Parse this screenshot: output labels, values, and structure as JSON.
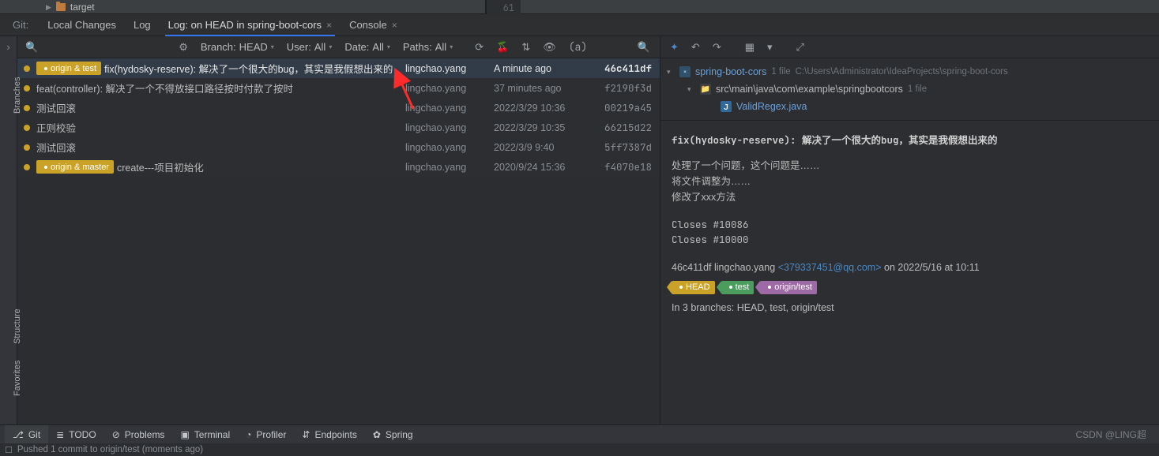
{
  "project": {
    "top_node": "target"
  },
  "editor_gutter": {
    "line": "61"
  },
  "tabs": {
    "label": "Git:",
    "items": [
      {
        "label": "Local Changes",
        "active": false,
        "closable": false
      },
      {
        "label": "Log",
        "active": false,
        "closable": false
      },
      {
        "label": "Log: on HEAD in spring-boot-cors",
        "active": true,
        "closable": true
      },
      {
        "label": "Console",
        "active": false,
        "closable": true
      }
    ]
  },
  "left_vertical": {
    "tabs": [
      "Branches"
    ],
    "lower": [
      "Structure",
      "Favorites"
    ]
  },
  "filters": {
    "branch_label": "Branch:",
    "branch_value": "HEAD",
    "user_label": "User:",
    "user_value": "All",
    "date_label": "Date:",
    "date_value": "All",
    "paths_label": "Paths:",
    "paths_value": "All"
  },
  "commits": [
    {
      "tags": [
        {
          "text": "origin & test",
          "style": "yellow",
          "icon": "purple"
        }
      ],
      "message": "fix(hydosky-reserve): 解决了一个很大的bug，其实是我假想出来的",
      "author": "lingchao.yang",
      "date": "A minute ago",
      "hash": "46c411df",
      "selected": true
    },
    {
      "tags": [],
      "message": "feat(controller): 解决了一个不得放接口路径按时付款了按时",
      "author": "lingchao.yang",
      "date": "37 minutes ago",
      "hash": "f2190f3d"
    },
    {
      "tags": [],
      "message": "测试回滚",
      "author": "lingchao.yang",
      "date": "2022/3/29 10:36",
      "hash": "00219a45"
    },
    {
      "tags": [],
      "message": "正则校验",
      "author": "lingchao.yang",
      "date": "2022/3/29 10:35",
      "hash": "66215d22"
    },
    {
      "tags": [],
      "message": "测试回滚",
      "author": "lingchao.yang",
      "date": "2022/3/9 9:40",
      "hash": "5ff7387d"
    },
    {
      "tags": [
        {
          "text": "origin & master",
          "style": "yellow",
          "icon": "purple"
        }
      ],
      "message": "create---项目初始化",
      "author": "lingchao.yang",
      "date": "2020/9/24 15:36",
      "hash": "f4070e18"
    }
  ],
  "files": {
    "root_name": "spring-boot-cors",
    "root_meta": "1 file",
    "root_path": "C:\\Users\\Administrator\\IdeaProjects\\spring-boot-cors",
    "pkg_name": "src\\main\\java\\com\\example\\springbootcors",
    "pkg_meta": "1 file",
    "file_name": "ValidRegex.java"
  },
  "detail": {
    "title": "fix(hydosky-reserve): 解决了一个很大的bug，其实是我假想出来的",
    "body": [
      "处理了一个问题，这个问题是……",
      "将文件调整为……",
      "修改了xxx方法"
    ],
    "closes": [
      "Closes #10086",
      "Closes #10000"
    ],
    "hash": "46c411df",
    "author": "lingchao.yang",
    "email_open": "<",
    "email": "379337451@qq.com",
    "email_close": ">",
    "date": " on 2022/5/16 at 10:11",
    "tags": [
      {
        "text": "HEAD",
        "style": "yellow"
      },
      {
        "text": "test",
        "style": "green"
      },
      {
        "text": "origin/test",
        "style": "purple"
      }
    ],
    "branches": "In 3 branches: HEAD, test, origin/test"
  },
  "bottom_tools": {
    "items": [
      {
        "label": "Git",
        "icon": "⎇",
        "active": true
      },
      {
        "label": "TODO",
        "icon": "≣"
      },
      {
        "label": "Problems",
        "icon": "⊘"
      },
      {
        "label": "Terminal",
        "icon": "▣"
      },
      {
        "label": "Profiler",
        "icon": "◔"
      },
      {
        "label": "Endpoints",
        "icon": "⇵"
      },
      {
        "label": "Spring",
        "icon": "✿"
      }
    ],
    "watermark": "CSDN @LING超"
  },
  "status": {
    "icon": "☐",
    "text": "Pushed 1 commit to origin/test (moments ago)"
  }
}
